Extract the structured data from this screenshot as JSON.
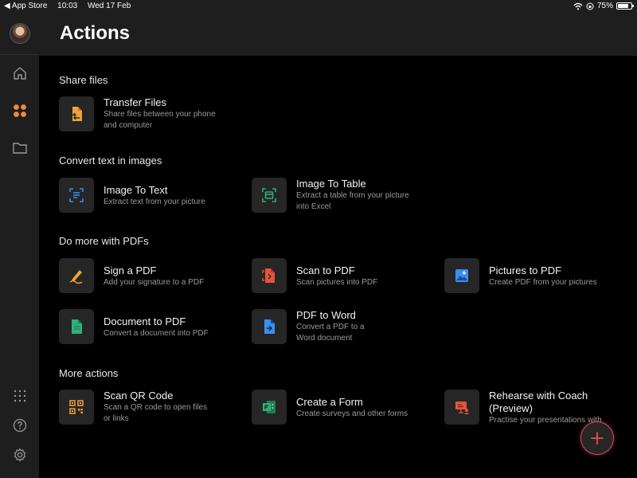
{
  "statusbar": {
    "back_app": "◀ App Store",
    "time": "10:03",
    "date": "Wed 17 Feb",
    "battery": "75%"
  },
  "header": {
    "title": "Actions"
  },
  "sections": {
    "share": {
      "title": "Share files",
      "items": [
        {
          "title": "Transfer Files",
          "subtitle_l1": "Share files between your phone",
          "subtitle_l2": "and computer",
          "icon": "transfer-icon"
        }
      ]
    },
    "convert": {
      "title": "Convert text in images",
      "items": [
        {
          "title": "Image To Text",
          "subtitle_l1": "Extract text from your picture",
          "subtitle_l2": "",
          "icon": "image-text-icon"
        },
        {
          "title": "Image To Table",
          "subtitle_l1": "Extract a table from your picture",
          "subtitle_l2": "into Excel",
          "icon": "image-table-icon"
        }
      ]
    },
    "pdf": {
      "title": "Do more with PDFs",
      "items": [
        {
          "title": "Sign a PDF",
          "subtitle_l1": "Add your signature to a PDF",
          "subtitle_l2": "",
          "icon": "signature-icon"
        },
        {
          "title": "Scan to PDF",
          "subtitle_l1": "Scan pictures into PDF",
          "subtitle_l2": "",
          "icon": "scan-pdf-icon"
        },
        {
          "title": "Pictures to PDF",
          "subtitle_l1": "Create PDF from your pictures",
          "subtitle_l2": "",
          "icon": "pictures-pdf-icon"
        },
        {
          "title": "Document to PDF",
          "subtitle_l1": "Convert a document into PDF",
          "subtitle_l2": "",
          "icon": "document-pdf-icon"
        },
        {
          "title": "PDF to Word",
          "subtitle_l1": "Convert a PDF to a",
          "subtitle_l2": "Word document",
          "icon": "pdf-word-icon"
        }
      ]
    },
    "more": {
      "title": "More actions",
      "items": [
        {
          "title": "Scan QR Code",
          "subtitle_l1": "Scan a QR code to open files",
          "subtitle_l2": "or links",
          "icon": "qr-code-icon"
        },
        {
          "title": "Create a Form",
          "subtitle_l1": "Create surveys and other forms",
          "subtitle_l2": "",
          "icon": "forms-icon"
        },
        {
          "title": "Rehearse with Coach",
          "title_l2": "(Preview)",
          "subtitle_l1": "Practise your presentations with",
          "subtitle_l2": "",
          "icon": "presenter-coach-icon"
        }
      ]
    }
  },
  "colors": {
    "accent_orange": "#f0883e",
    "accent_blue": "#3b8ef0",
    "accent_green": "#2fb07a",
    "accent_red": "#e5533d",
    "fab_border": "#d9486a"
  }
}
